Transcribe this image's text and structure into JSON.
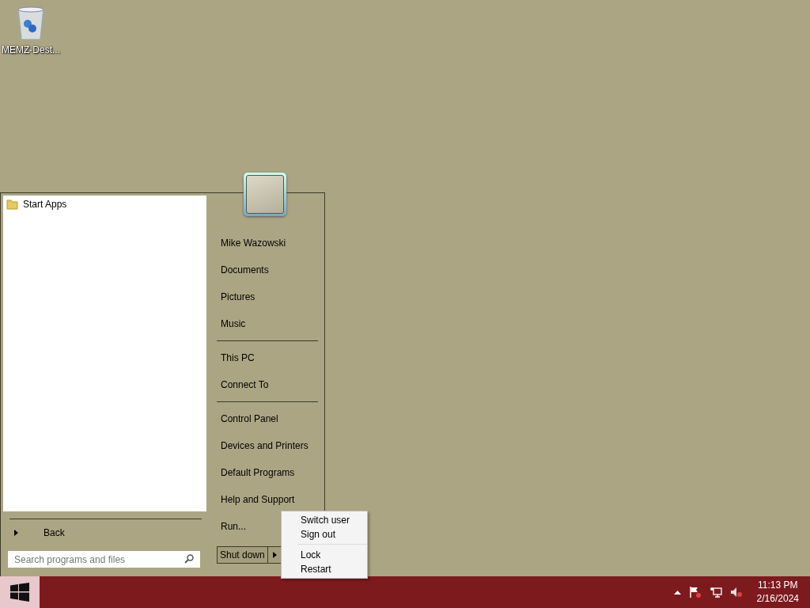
{
  "desktop_icons": [
    {
      "label": "MEMZ-Dest..."
    }
  ],
  "start_menu": {
    "programs": [
      {
        "label": "Start Apps"
      }
    ],
    "back": "Back",
    "search": {
      "placeholder": "Search programs and files"
    },
    "groups": [
      [
        "Mike Wazowski",
        "Documents",
        "Pictures",
        "Music"
      ],
      [
        "This PC",
        "Connect To"
      ],
      [
        "Control Panel",
        "Devices and Printers",
        "Default Programs",
        "Help and Support",
        "Run..."
      ]
    ],
    "shutdown": {
      "label": "Shut down"
    },
    "power_menu": [
      [
        "Switch user",
        "Sign out"
      ],
      [
        "Lock",
        "Restart"
      ]
    ]
  },
  "taskbar": {
    "time": "11:13 PM",
    "date": "2/16/2024"
  }
}
